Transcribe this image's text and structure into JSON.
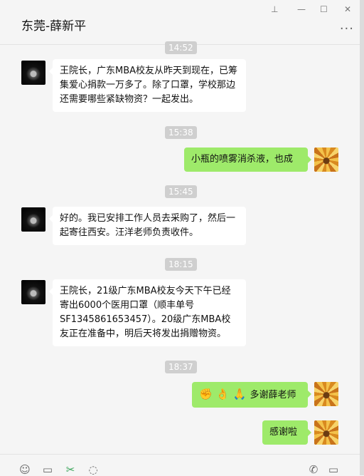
{
  "window": {
    "title": "东莞-薛新平",
    "pin_glyph": "⊥",
    "minimize_glyph": "—",
    "maximize_glyph": "☐",
    "close_glyph": "✕",
    "more_glyph": "···"
  },
  "timestamps": {
    "t0": "14:52",
    "t1": "15:38",
    "t2": "15:45",
    "t3": "18:15",
    "t4": "18:37"
  },
  "messages": [
    {
      "sender": "contact",
      "text": "王院长，广东MBA校友从昨天到现在，已筹集爱心捐款一万多了。除了口罩，学校那边还需要哪些紧缺物资？一起发出。"
    },
    {
      "sender": "self",
      "text": "小瓶的喷雾消杀液，也成"
    },
    {
      "sender": "contact",
      "text": "好的。我已安排工作人员去采购了，然后一起寄往西安。汪洋老师负责收件。"
    },
    {
      "sender": "contact",
      "text": "王院长，21级广东MBA校友今天下午已经寄出6000个医用口罩（顺丰单号SF1345861653457）。20级广东MBA校友正在准备中，明后天将发出捐赠物资。"
    },
    {
      "sender": "self",
      "emojis": [
        "✊",
        "👌",
        "🙏"
      ],
      "text": "多谢薛老师"
    },
    {
      "sender": "self",
      "text": "感谢啦"
    }
  ],
  "toolbar": {
    "emoji_icon": "☺",
    "folder_icon": "▭",
    "scissors_icon": "✂",
    "chat_icon": "◌",
    "phone_icon": "✆",
    "video_icon": "▭"
  },
  "colors": {
    "self_bubble": "#9eea6a",
    "contact_bubble": "#ffffff",
    "background": "#f5f5f5",
    "timestamp_bg": "#cfcfcf"
  }
}
